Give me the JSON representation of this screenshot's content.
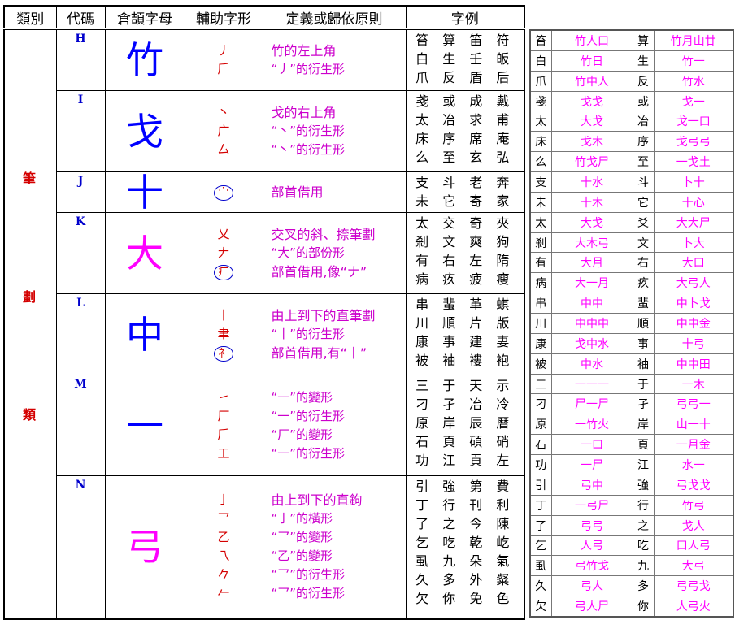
{
  "headers": [
    "類別",
    "代碼",
    "倉頡字母",
    "輔助字形",
    "定義或歸依原則",
    "字例"
  ],
  "category_chars": [
    "筆",
    "劃",
    "類"
  ],
  "rows": [
    {
      "code": "H",
      "root": "竹",
      "root_color": "#0000ff",
      "aux": [
        "丿",
        "𠂆"
      ],
      "defs": [
        "竹的左上角",
        "“丿”的衍生形"
      ],
      "examples": [
        "笞 算 笛 符",
        "白 生 壬 皈",
        "爪 反 盾 后"
      ]
    },
    {
      "code": "I",
      "root": "戈",
      "root_color": "#0000ff",
      "aux": [
        "丶",
        "广",
        "厶"
      ],
      "defs": [
        "戈的右上角",
        "“丶”的衍生形",
        "“丶”的衍生形"
      ],
      "examples": [
        "戔 或 成 戴",
        "太 冶 求 甫",
        "床 序 席 庵",
        "么 至 玄 弘"
      ]
    },
    {
      "code": "J",
      "root": "十",
      "root_color": "#0000ff",
      "aux": [
        "宀"
      ],
      "defs": [
        "部首借用"
      ],
      "examples": [
        "支 斗 老 奔",
        "未 它 寄 家"
      ]
    },
    {
      "code": "K",
      "root": "大",
      "root_color": "#ff00ff",
      "aux": [
        "乂",
        "𠂇",
        "疒"
      ],
      "defs": [
        "交叉的斜、捺筆劃",
        "“大”的部份形",
        "部首借用,像“ナ”"
      ],
      "examples": [
        "太 交 奇 夾",
        "剎 文 爽 狗",
        "有 右 左 隋",
        "病 疚 疲 瘦"
      ]
    },
    {
      "code": "L",
      "root": "中",
      "root_color": "#0000ff",
      "aux": [
        "丨",
        "聿",
        "衤"
      ],
      "defs": [
        "由上到下的直筆劃",
        "“丨”的衍生形",
        "部首借用,有“丨”"
      ],
      "examples": [
        "串 蜚 革 蜞",
        "川 順 片 版",
        "康 事 建 妻",
        "被 袖 褸 袍"
      ]
    },
    {
      "code": "M",
      "root": "一",
      "root_color": "#0000ff",
      "aux": [
        "㇀",
        "厂",
        "𠂆",
        "工"
      ],
      "defs": [
        "“一”的變形",
        "“一”的衍生形",
        "“厂”的變形",
        "“一”的衍生形"
      ],
      "examples": [
        "三 于 天 示",
        "刁 孑 冶 冷",
        "原 岸 辰 曆",
        "石 頁 碩 硝",
        "功 江 貢 左"
      ]
    },
    {
      "code": "N",
      "root": "弓",
      "root_color": "#ff00ff",
      "aux": [
        "亅",
        "乛",
        "乙",
        "乁",
        "𠂊",
        "𠂉"
      ],
      "defs": [
        "由上到下的直鉤",
        "“亅”的橫形",
        "“乛”的變形",
        "“乙”的變形",
        "“乛”的衍生形",
        "“乛”的衍生形"
      ],
      "examples": [
        "引 強 第 費",
        "丁 行 刊 利",
        "了 之 今 陳",
        "乞 吃 乾 屹",
        "虱 九 朵 氣",
        "久 多 外 粲",
        "欠 你 免 色"
      ]
    }
  ],
  "side_rows": [
    [
      "笞",
      "竹人口",
      "算",
      "竹月山廿"
    ],
    [
      "白",
      "竹日",
      "生",
      "竹一"
    ],
    [
      "爪",
      "竹中人",
      "反",
      "竹水"
    ],
    [
      "戔",
      "戈戈",
      "或",
      "戈一"
    ],
    [
      "太",
      "大戈",
      "冶",
      "戈一口"
    ],
    [
      "床",
      "戈木",
      "序",
      "戈弓弓"
    ],
    [
      "么",
      "竹戈尸",
      "至",
      "一戈土"
    ],
    [
      "支",
      "十水",
      "斗",
      "卜十"
    ],
    [
      "未",
      "十木",
      "它",
      "十心"
    ],
    [
      "太",
      "大戈",
      "爻",
      "大大尸"
    ],
    [
      "剎",
      "大木弓",
      "文",
      "卜大"
    ],
    [
      "有",
      "大月",
      "右",
      "大口"
    ],
    [
      "病",
      "大一月",
      "疚",
      "大弓人"
    ],
    [
      "串",
      "中中",
      "蜚",
      "中卜戈"
    ],
    [
      "川",
      "中中中",
      "順",
      "中中金"
    ],
    [
      "康",
      "戈中水",
      "事",
      "十弓"
    ],
    [
      "被",
      "中水",
      "袖",
      "中中田"
    ],
    [
      "三",
      "一一一",
      "于",
      "一木"
    ],
    [
      "刁",
      "尸一尸",
      "孑",
      "弓弓一"
    ],
    [
      "原",
      "一竹火",
      "岸",
      "山一十"
    ],
    [
      "石",
      "一口",
      "頁",
      "一月金"
    ],
    [
      "功",
      "一尸",
      "江",
      "水一"
    ],
    [
      "引",
      "弓中",
      "強",
      "弓戈戈"
    ],
    [
      "丁",
      "一弓尸",
      "行",
      "竹弓"
    ],
    [
      "了",
      "弓弓",
      "之",
      "戈人"
    ],
    [
      "乞",
      "人弓",
      "吃",
      "口人弓"
    ],
    [
      "虱",
      "弓竹戈",
      "九",
      "大弓"
    ],
    [
      "久",
      "弓人",
      "多",
      "弓弓戈"
    ],
    [
      "欠",
      "弓人尸",
      "你",
      "人弓火"
    ]
  ]
}
